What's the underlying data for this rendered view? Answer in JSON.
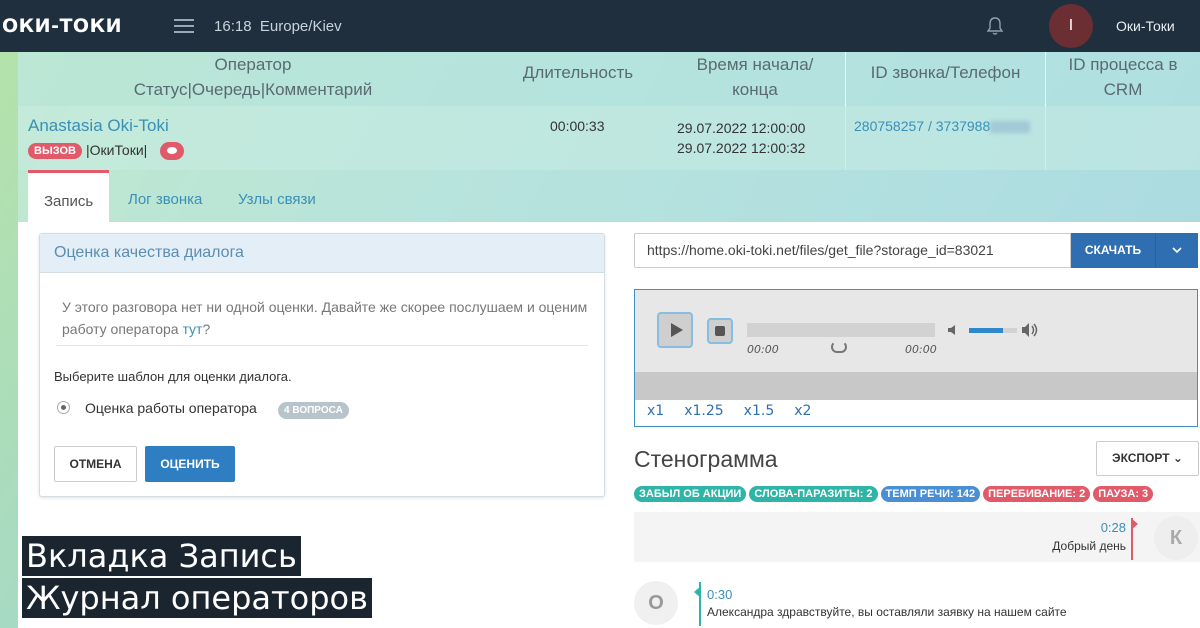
{
  "topbar": {
    "logo": "ОКИ-ТОКИ",
    "time": "16:18",
    "timezone": "Europe/Kiev",
    "avatar_initial": "I",
    "user_name": "Оки-Токи"
  },
  "table": {
    "headers": {
      "operator_line1": "Оператор",
      "operator_line2": "Статус|Очередь|Комментарий",
      "duration": "Длительность",
      "time_line1": "Время начала/",
      "time_line2": "конца",
      "callid": "ID звонка/Телефон",
      "crm_line1": "ID процесса в",
      "crm_line2": "CRM"
    },
    "row": {
      "operator": "Anastasia Oki-Toki",
      "status": "ВЫЗОВ",
      "queue": "|ОкиТоки|",
      "duration": "00:00:33",
      "start": "29.07.2022 12:00:00",
      "end": "29.07.2022 12:00:32",
      "callid": "280758257 / 3737988"
    }
  },
  "tabs": [
    "Запись",
    "Лог звонка",
    "Узлы связи"
  ],
  "rating_panel": {
    "title": "Оценка качества диалога",
    "note_text": "У этого разговора нет ни одной оценки. Давайте же скорее послушаем и оценим работу оператора ",
    "note_link": "тут",
    "note_end": "?",
    "template_label": "Выберите шаблон для оценки диалога.",
    "template_name": "Оценка работы оператора",
    "template_badge": "4 ВОПРОСА",
    "cancel_label": "ОТМЕНА",
    "rate_label": "ОЦЕНИТЬ"
  },
  "download": {
    "url": "https://home.oki-toki.net/files/get_file?storage_id=83021",
    "button_label": "СКАЧАТЬ"
  },
  "player": {
    "time_start": "00:00",
    "time_end": "00:00",
    "volume_level": 0.7,
    "speeds": [
      "x1",
      "x1.25",
      "x1.5",
      "x2"
    ]
  },
  "transcript": {
    "title": "Стенограмма",
    "export_label": "ЭКСПОРТ ⌄",
    "tags": [
      {
        "label": "ЗАБЫЛ ОБ АКЦИИ",
        "color": "#2fb5a8"
      },
      {
        "label": "СЛОВА-ПАРАЗИТЫ: 2",
        "color": "#2fb5a8"
      },
      {
        "label": "ТЕМП РЕЧИ: 142",
        "color": "#4a8fd4"
      },
      {
        "label": "ПЕРЕБИВАНИЕ: 2",
        "color": "#e05a6a"
      },
      {
        "label": "ПАУЗА: 3",
        "color": "#e05a6a"
      }
    ],
    "messages": [
      {
        "speaker": "К",
        "time": "0:28",
        "text": "Добрый день"
      },
      {
        "speaker": "О",
        "time": "0:30",
        "text": "Александра здравствуйте, вы оставляли заявку на нашем сайте"
      }
    ]
  },
  "caption": {
    "line1": "Вкладка Запись",
    "line2": "Журнал операторов"
  }
}
